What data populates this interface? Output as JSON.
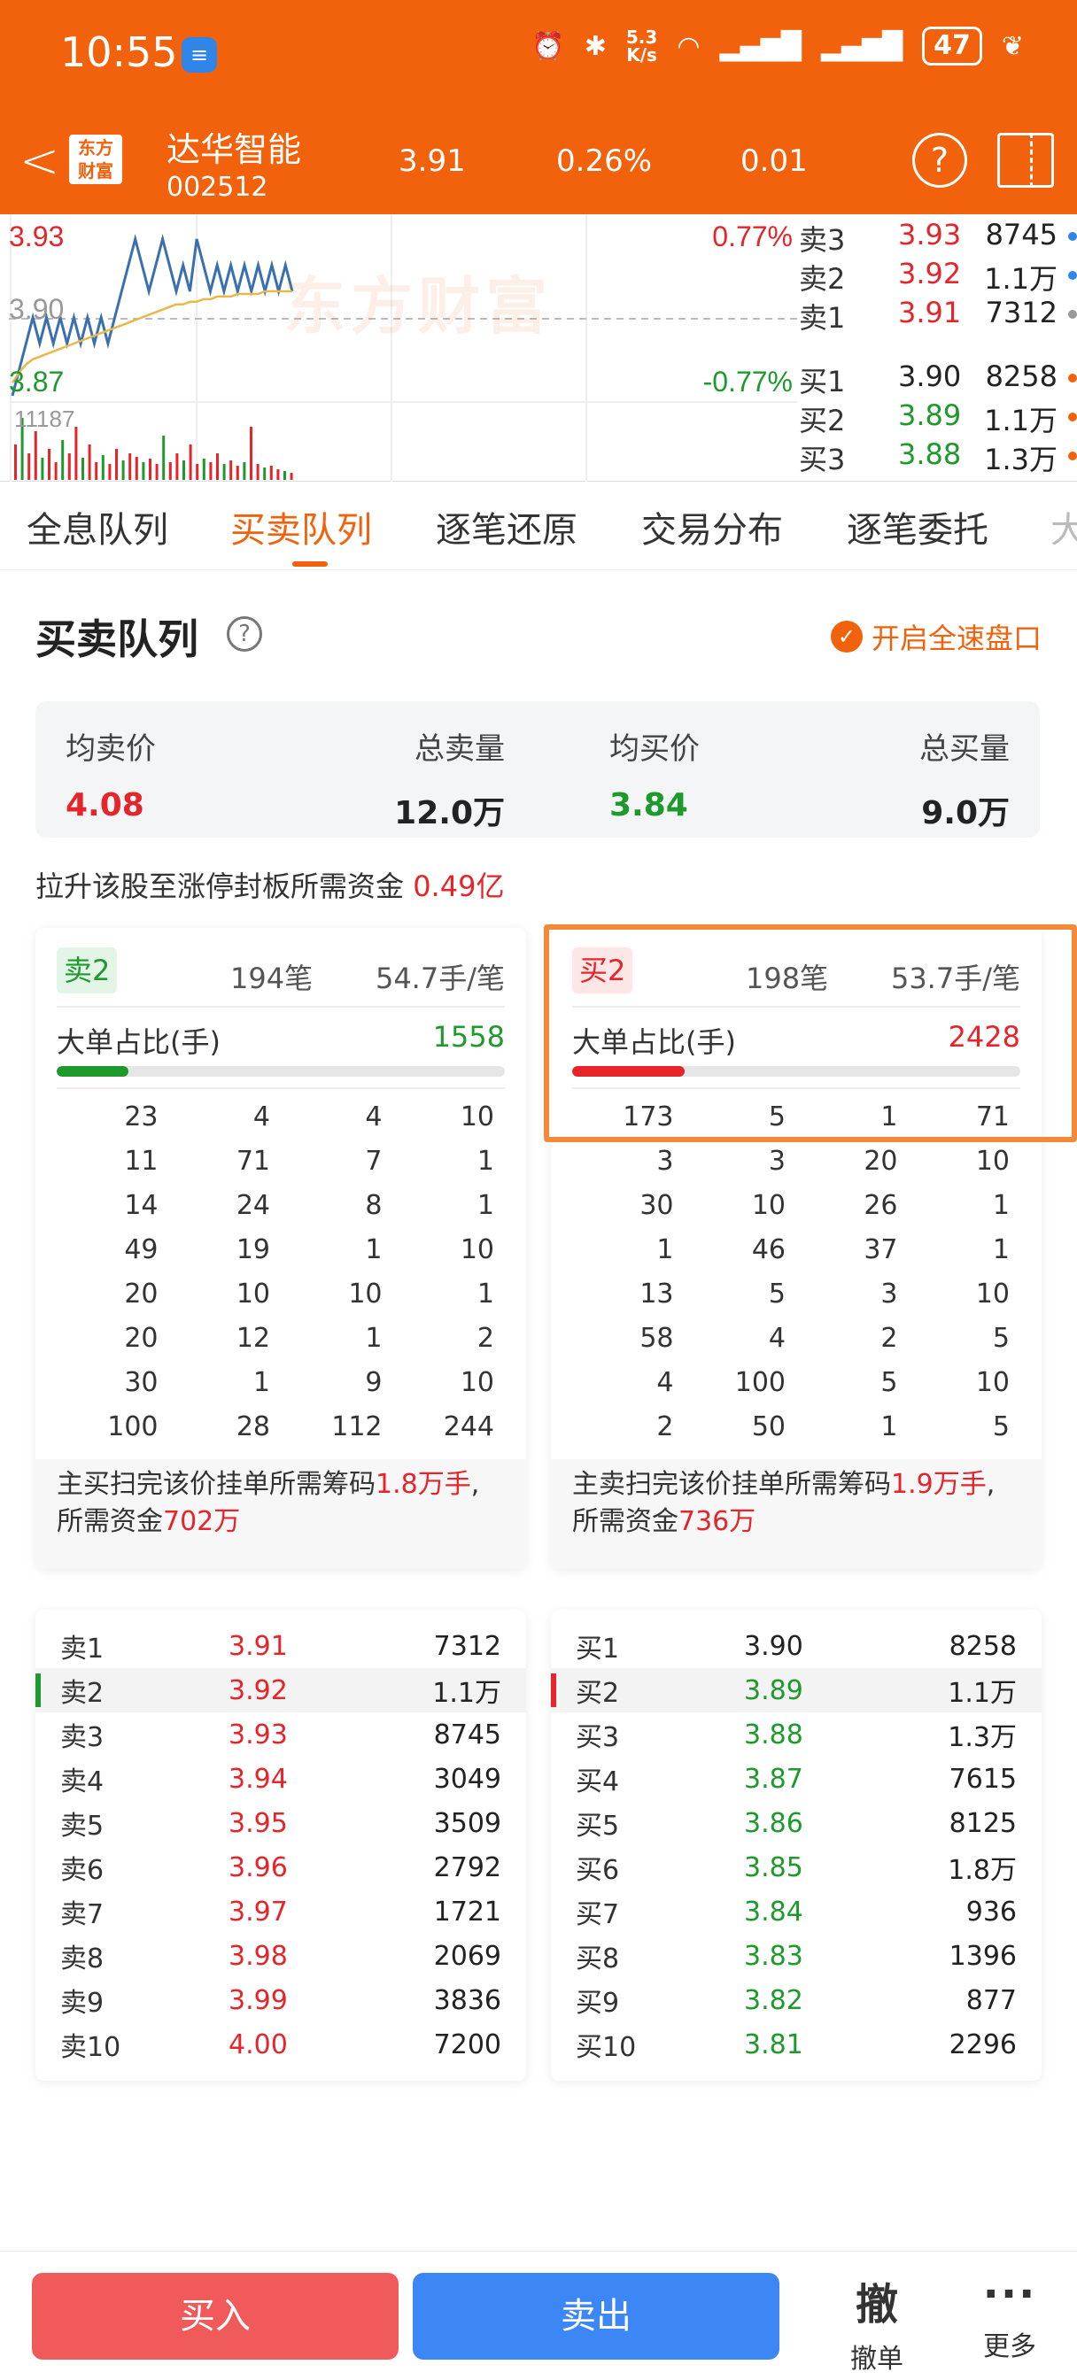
{
  "status": {
    "time": "10:55",
    "net_speed_top": "5.3",
    "net_speed_bottom": "K/s",
    "battery": "47"
  },
  "header": {
    "logo_line1": "东方",
    "logo_line2": "财富",
    "name": "达华智能",
    "code": "002512",
    "price": "3.91",
    "pct": "0.26%",
    "change": "0.01"
  },
  "chart": {
    "price_high": "3.93",
    "price_mid": "3.90",
    "price_low": "3.87",
    "pct_high": "0.77%",
    "pct_low": "-0.77%",
    "volume_max": "11187",
    "watermark": "东方财富",
    "minute_prices": [
      3.87,
      3.88,
      3.89,
      3.9,
      3.89,
      3.9,
      3.89,
      3.9,
      3.89,
      3.9,
      3.89,
      3.9,
      3.89,
      3.9,
      3.89,
      3.9,
      3.91,
      3.92,
      3.93,
      3.92,
      3.91,
      3.92,
      3.93,
      3.92,
      3.91,
      3.92,
      3.91,
      3.93,
      3.92,
      3.91,
      3.92,
      3.91,
      3.92,
      3.91,
      3.92,
      3.91,
      3.92,
      3.91,
      3.92,
      3.91,
      3.92,
      3.91
    ],
    "avg_prices": [
      3.875,
      3.879,
      3.882,
      3.884,
      3.885,
      3.886,
      3.887,
      3.888,
      3.889,
      3.89,
      3.891,
      3.892,
      3.893,
      3.894,
      3.895,
      3.896,
      3.897,
      3.898,
      3.899,
      3.9,
      3.901,
      3.902,
      3.903,
      3.904,
      3.905,
      3.905,
      3.906,
      3.906,
      3.907,
      3.907,
      3.908,
      3.908,
      3.908,
      3.909,
      3.909,
      3.909,
      3.909,
      3.91,
      3.91,
      3.91,
      3.91,
      3.91
    ]
  },
  "orderbook": {
    "asks": [
      {
        "label": "卖3",
        "price": "3.93",
        "vol": "8745",
        "dot": "#2f86e8"
      },
      {
        "label": "卖2",
        "price": "3.92",
        "vol": "1.1万",
        "dot": "#2f86e8"
      },
      {
        "label": "卖1",
        "price": "3.91",
        "vol": "7312",
        "dot": "#999999"
      }
    ],
    "bids": [
      {
        "label": "买1",
        "price": "3.90",
        "vol": "8258",
        "dot": "#f2620c"
      },
      {
        "label": "买2",
        "price": "3.89",
        "vol": "1.1万",
        "dot": "#f2620c"
      },
      {
        "label": "买3",
        "price": "3.88",
        "vol": "1.3万",
        "dot": "#f2620c"
      }
    ]
  },
  "tabs": [
    "全息队列",
    "买卖队列",
    "逐笔还原",
    "交易分布",
    "逐笔委托",
    "大"
  ],
  "section": {
    "title": "买卖队列",
    "fast_label": "开启全速盘口"
  },
  "summary": {
    "avg_sell_label": "均卖价",
    "avg_sell": "4.08",
    "total_sell_label": "总卖量",
    "total_sell": "12.0万",
    "avg_buy_label": "均买价",
    "avg_buy": "3.84",
    "total_buy_label": "总买量",
    "total_buy": "9.0万"
  },
  "limit_text": "拉升该股至涨停封板所需资金",
  "limit_value": "0.49亿",
  "sell_queue": {
    "tag": "卖2",
    "count": "194笔",
    "per": "54.7手/笔",
    "big_label": "大单占比(手)",
    "big_value": "1558",
    "big_ratio": 0.16,
    "rows": [
      [
        "23",
        "4",
        "4",
        "10"
      ],
      [
        "11",
        "71",
        "7",
        "1"
      ],
      [
        "14",
        "24",
        "8",
        "1"
      ],
      [
        "49",
        "19",
        "1",
        "10"
      ],
      [
        "20",
        "10",
        "10",
        "1"
      ],
      [
        "20",
        "12",
        "1",
        "2"
      ],
      [
        "30",
        "1",
        "9",
        "10"
      ],
      [
        "100",
        "28",
        "112",
        "244"
      ]
    ],
    "note_a": "主买扫完该价挂单所需筹码",
    "note_b": "1.8万",
    "note_c": "手",
    "note_d": ",所需资金",
    "note_e": "702万"
  },
  "buy_queue": {
    "tag": "买2",
    "count": "198笔",
    "per": "53.7手/笔",
    "big_label": "大单占比(手)",
    "big_value": "2428",
    "big_ratio": 0.25,
    "rows": [
      [
        "173",
        "5",
        "1",
        "71"
      ],
      [
        "3",
        "3",
        "20",
        "10"
      ],
      [
        "30",
        "10",
        "26",
        "1"
      ],
      [
        "1",
        "46",
        "37",
        "1"
      ],
      [
        "13",
        "5",
        "3",
        "10"
      ],
      [
        "58",
        "4",
        "2",
        "5"
      ],
      [
        "4",
        "100",
        "5",
        "10"
      ],
      [
        "2",
        "50",
        "1",
        "5"
      ]
    ],
    "note_a": "主卖扫完该价挂单所需筹码",
    "note_b": "1.9万",
    "note_c": "手",
    "note_d": ",所需资金",
    "note_e": "736万"
  },
  "sell_book": [
    {
      "label": "卖1",
      "price": "3.91",
      "vol": "7312"
    },
    {
      "label": "卖2",
      "price": "3.92",
      "vol": "1.1万"
    },
    {
      "label": "卖3",
      "price": "3.93",
      "vol": "8745"
    },
    {
      "label": "卖4",
      "price": "3.94",
      "vol": "3049"
    },
    {
      "label": "卖5",
      "price": "3.95",
      "vol": "3509"
    },
    {
      "label": "卖6",
      "price": "3.96",
      "vol": "2792"
    },
    {
      "label": "卖7",
      "price": "3.97",
      "vol": "1721"
    },
    {
      "label": "卖8",
      "price": "3.98",
      "vol": "2069"
    },
    {
      "label": "卖9",
      "price": "3.99",
      "vol": "3836"
    },
    {
      "label": "卖10",
      "price": "4.00",
      "vol": "7200"
    }
  ],
  "buy_book": [
    {
      "label": "买1",
      "price": "3.90",
      "vol": "8258"
    },
    {
      "label": "买2",
      "price": "3.89",
      "vol": "1.1万"
    },
    {
      "label": "买3",
      "price": "3.88",
      "vol": "1.3万"
    },
    {
      "label": "买4",
      "price": "3.87",
      "vol": "7615"
    },
    {
      "label": "买5",
      "price": "3.86",
      "vol": "8125"
    },
    {
      "label": "买6",
      "price": "3.85",
      "vol": "1.8万"
    },
    {
      "label": "买7",
      "price": "3.84",
      "vol": "936"
    },
    {
      "label": "买8",
      "price": "3.83",
      "vol": "1396"
    },
    {
      "label": "买9",
      "price": "3.82",
      "vol": "877"
    },
    {
      "label": "买10",
      "price": "3.81",
      "vol": "2296"
    }
  ],
  "bottom": {
    "buy": "买入",
    "sell": "卖出",
    "cancel_icon": "撤",
    "cancel": "撤单",
    "more_icon": "···",
    "more": "更多"
  },
  "colors": {
    "brand": "#f2620c",
    "up": "#e5252a",
    "down": "#1e9a2c",
    "buy_button": "#f05a5a",
    "sell_button": "#3d86f5"
  }
}
